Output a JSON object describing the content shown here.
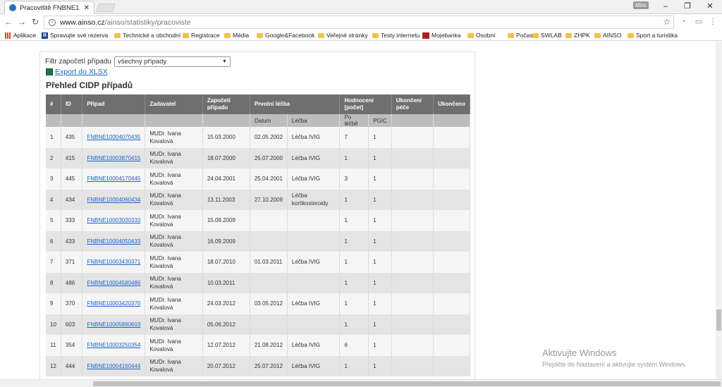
{
  "browser": {
    "tab_title": "Pracoviště FNBNE1 | Léč",
    "tab_close": "✕",
    "user_badge": "Miro",
    "url_host": "www.ainso.cz",
    "url_path": "/ainso/statistiky/pracoviste",
    "bookmarks": [
      {
        "label": "Aplikace",
        "icon": "apps-icon"
      },
      {
        "label": "Spravujte své rezerva",
        "icon": "b-icon"
      },
      {
        "label": "Technické a obchodní",
        "icon": "folder-icon"
      },
      {
        "label": "Registrace",
        "icon": "folder-icon"
      },
      {
        "label": "Média",
        "icon": "folder-icon"
      },
      {
        "label": "Google&Facebook",
        "icon": "folder-icon"
      },
      {
        "label": "Veřejné stránky",
        "icon": "folder-icon"
      },
      {
        "label": "Testy internetu",
        "icon": "folder-icon"
      },
      {
        "label": "Mojebanka",
        "icon": "mojebanka-icon"
      },
      {
        "label": "Osobní",
        "icon": "folder-icon"
      },
      {
        "label": "Počasí",
        "icon": "folder-icon"
      },
      {
        "label": "SWLAB",
        "icon": "folder-icon"
      },
      {
        "label": "ZHPK",
        "icon": "folder-icon"
      },
      {
        "label": "AINSO",
        "icon": "folder-icon"
      },
      {
        "label": "Sport a turistika",
        "icon": "folder-icon"
      }
    ]
  },
  "filter": {
    "label": "Filtr započetí případu",
    "selected": "všechny případy"
  },
  "export_label": "Export do XLSX",
  "section_title": "Přehled CIDP případů",
  "table": {
    "headers": [
      "#",
      "ID",
      "Případ",
      "Zadavatel",
      "Započetí případu",
      "Prvotní léčba",
      "Hodnocení [počet]",
      "Ukončení péče",
      "Ukončeno"
    ],
    "subheaders": [
      "",
      "",
      "",
      "",
      "",
      "Datum",
      "Léčba",
      "Po léčbě",
      "PGIC",
      "",
      ""
    ],
    "rows": [
      {
        "n": "1",
        "id": "435",
        "case": "FNBNE10004070435",
        "req": "MUDr. Ivana Kovalová",
        "start": "15.03.2000",
        "date": "02.05.2002",
        "tx": "Léčba IVIG",
        "after": "7",
        "pgic": "1"
      },
      {
        "n": "2",
        "id": "415",
        "case": "FNBNE10003870415",
        "req": "MUDr. Ivana Kovalová",
        "start": "18.07.2000",
        "date": "25.07.2000",
        "tx": "Léčba IVIG",
        "after": "1",
        "pgic": "1"
      },
      {
        "n": "3",
        "id": "445",
        "case": "FNBNE10004170445",
        "req": "MUDr. Ivana Kovalová",
        "start": "24.04.2001",
        "date": "25.04.2001",
        "tx": "Léčba IVIG",
        "after": "3",
        "pgic": "1"
      },
      {
        "n": "4",
        "id": "434",
        "case": "FNBNE10004060434",
        "req": "MUDr. Ivana Kovalová",
        "start": "13.11.2003",
        "date": "27.10.2009",
        "tx": "Léčba kortikosteroidy",
        "after": "1",
        "pgic": "1"
      },
      {
        "n": "5",
        "id": "333",
        "case": "FNBNE10003030333",
        "req": "MUDr. Ivana Kovalová",
        "start": "15.09.2009",
        "date": "",
        "tx": "",
        "after": "1",
        "pgic": "1"
      },
      {
        "n": "6",
        "id": "433",
        "case": "FNBNE10004050433",
        "req": "MUDr. Ivana Kovalová",
        "start": "16.09.2009",
        "date": "",
        "tx": "",
        "after": "1",
        "pgic": "1"
      },
      {
        "n": "7",
        "id": "371",
        "case": "FNBNE10003430371",
        "req": "MUDr. Ivana Kovalová",
        "start": "18.07.2010",
        "date": "01.03.2011",
        "tx": "Léčba IVIG",
        "after": "1",
        "pgic": "1"
      },
      {
        "n": "8",
        "id": "486",
        "case": "FNBNE10004580486",
        "req": "MUDr. Ivana Kovalová",
        "start": "10.03.2011",
        "date": "",
        "tx": "",
        "after": "1",
        "pgic": "1"
      },
      {
        "n": "9",
        "id": "370",
        "case": "FNBNE10003420370",
        "req": "MUDr. Ivana Kovalová",
        "start": "24.03.2012",
        "date": "03.05.2012",
        "tx": "Léčba IVIG",
        "after": "1",
        "pgic": "1"
      },
      {
        "n": "10",
        "id": "603",
        "case": "FNBNE10005890603",
        "req": "MUDr. Ivana Kovalová",
        "start": "05.06.2012",
        "date": "",
        "tx": "",
        "after": "1",
        "pgic": "1"
      },
      {
        "n": "11",
        "id": "354",
        "case": "FNBNE10003250354",
        "req": "MUDr. Ivana Kovalová",
        "start": "12.07.2012",
        "date": "21.08.2012",
        "tx": "Léčba IVIG",
        "after": "6",
        "pgic": "1"
      },
      {
        "n": "12",
        "id": "444",
        "case": "FNBNE10004160444",
        "req": "MUDr. Ivana Kovalová",
        "start": "20.07.2012",
        "date": "25.07.2012",
        "tx": "Léčba IVIG",
        "after": "1",
        "pgic": "1"
      }
    ]
  },
  "watermark": {
    "title": "Aktivujte Windows",
    "subtitle": "Přejděte do Nastavení a aktivujte systém Windows."
  }
}
